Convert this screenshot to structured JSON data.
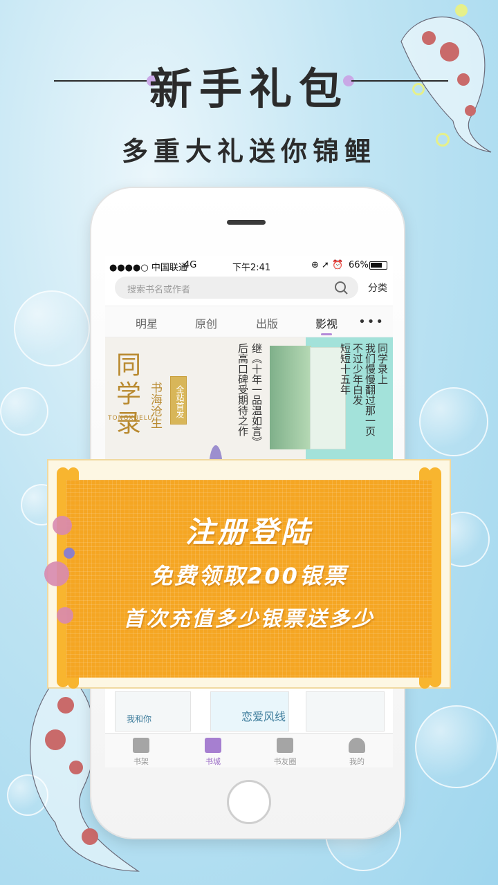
{
  "promo": {
    "title": "新手礼包",
    "subtitle": "多重大礼送你锦鲤"
  },
  "status_bar": {
    "carrier": "●●●●○ 中国联通",
    "network": "4G",
    "time": "下午2:41",
    "icons": "⊕ ➚ ⏰",
    "battery_text": "66%",
    "battery_level": 0.66
  },
  "search": {
    "placeholder": "搜索书名或作者",
    "category_label": "分类"
  },
  "tabs": [
    {
      "label": "明星"
    },
    {
      "label": "原创"
    },
    {
      "label": "出版"
    },
    {
      "label": "影视"
    }
  ],
  "more_label": "•••",
  "banner": {
    "title_chars": "同学录",
    "pinyin": "TONGXUELU",
    "author": "书海沧生",
    "badge": "全站首发",
    "slogan_lines": [
      "继《十年一品温如言》",
      "后高口碑受期待之作"
    ],
    "right_lines": [
      "同学录上",
      "我们慢慢翻过那一页",
      "不过少年白发",
      "短短十五年"
    ]
  },
  "cards": [
    {
      "text": "我和你"
    },
    {
      "text": "恋爱风线"
    },
    {
      "text": ""
    }
  ],
  "bottom_nav": [
    {
      "label": "书架",
      "icon": "bookshelf-icon"
    },
    {
      "label": "书城",
      "icon": "bookstore-icon"
    },
    {
      "label": "书友圈",
      "icon": "chat-icon"
    },
    {
      "label": "我的",
      "icon": "profile-icon"
    }
  ],
  "overlay": {
    "title": "注册登陆",
    "line2": "免费领取200银票",
    "line3": "首次充值多少银票送多少"
  },
  "colors": {
    "accent_purple": "#b48ad8",
    "promo_orange": "#f5a623",
    "banner_gold": "#b98a30"
  }
}
